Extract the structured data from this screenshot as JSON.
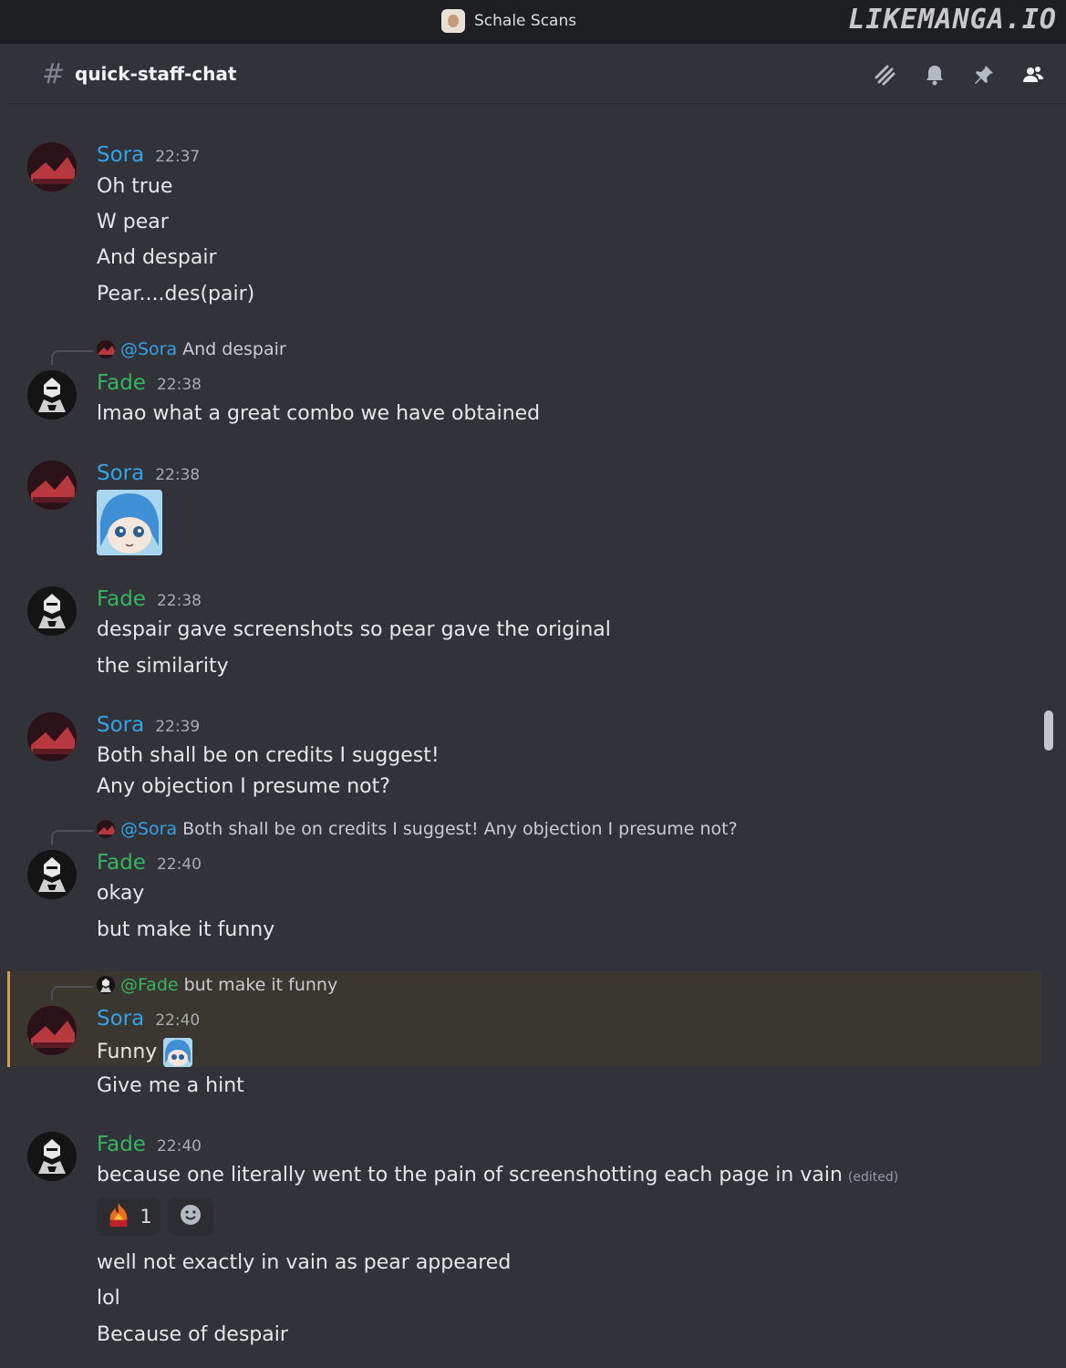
{
  "window": {
    "server_name": "Schale Scans",
    "watermark": "LIKEMANGA.IO"
  },
  "channel": {
    "name": "quick-staff-chat",
    "icons": [
      "threads-icon",
      "bell-icon",
      "pin-icon",
      "members-icon"
    ]
  },
  "messages": [
    {
      "author": "Sora",
      "time": "22:37",
      "lines": [
        "Oh true",
        "W pear",
        "And despair",
        "Pear....des(pair)"
      ]
    },
    {
      "reply": {
        "mention": "@Sora",
        "text": "And despair"
      },
      "author": "Fade",
      "time": "22:38",
      "lines": [
        "lmao what a great combo we have obtained"
      ]
    },
    {
      "author": "Sora",
      "time": "22:38",
      "sticker": "anime-girl-sticker"
    },
    {
      "author": "Fade",
      "time": "22:38",
      "lines": [
        "despair gave screenshots so pear gave the original",
        "the similarity"
      ]
    },
    {
      "author": "Sora",
      "time": "22:39",
      "lines": [
        "Both shall be on credits I suggest!",
        "Any objection I presume not?"
      ]
    },
    {
      "reply": {
        "mention": "@Sora",
        "text": "Both shall be on credits I suggest! Any objection I presume not?"
      },
      "author": "Fade",
      "time": "22:40",
      "lines": [
        "okay",
        "but make it funny"
      ]
    },
    {
      "reply": {
        "mention": "@Fade",
        "text": "but make it funny"
      },
      "author": "Sora",
      "time": "22:40",
      "lines": [
        "Funny",
        "Give me a hint"
      ],
      "highlighted": true
    },
    {
      "author": "Fade",
      "time": "22:40",
      "lines": [
        "because one literally went to the pain of screenshotting each page in vain",
        "well not exactly in vain as pear appeared",
        "lol",
        "Because of despair"
      ],
      "edited": "(edited)",
      "reaction": {
        "emoji": "fire-emoji",
        "count": "1"
      }
    }
  ],
  "colors": {
    "background": "#313338",
    "sora": "#33a2e6",
    "fade": "#36b560",
    "highlight": "#3a3630",
    "highlight_bar": "#d99b4c"
  }
}
